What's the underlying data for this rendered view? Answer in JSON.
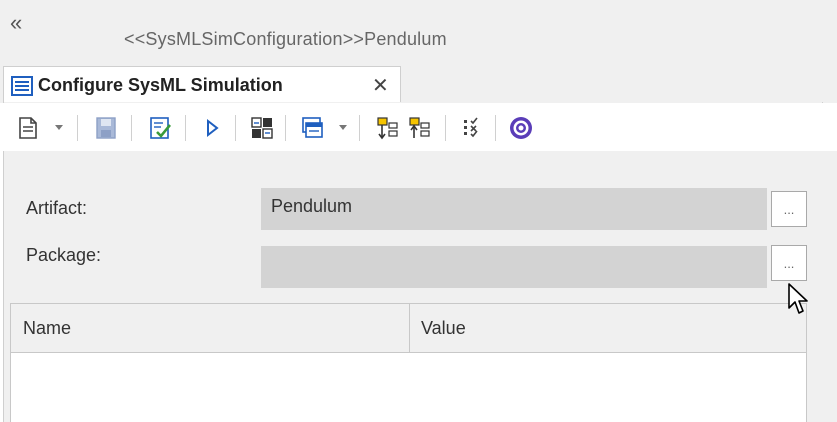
{
  "window": {
    "collapse_glyph": "«",
    "title": "<<SysMLSimConfiguration>>Pendulum"
  },
  "tab": {
    "label": "Configure SysML Simulation",
    "close_glyph": "✕",
    "icon": "document-list-icon"
  },
  "toolbar": {
    "buttons": [
      {
        "name": "new-document-icon",
        "dropdown": true
      },
      {
        "name": "save-icon"
      },
      {
        "name": "validate-icon"
      },
      {
        "name": "run-icon"
      },
      {
        "name": "generate-model-icon"
      },
      {
        "name": "windows-icon",
        "dropdown": true
      },
      {
        "name": "move-down-icon"
      },
      {
        "name": "move-up-icon"
      },
      {
        "name": "checklist-icon"
      },
      {
        "name": "help-icon"
      }
    ]
  },
  "form": {
    "artifact_label": "Artifact:",
    "artifact_value": "Pendulum",
    "package_label": "Package:",
    "package_value": "",
    "browse_label": "..."
  },
  "grid": {
    "columns": [
      "Name",
      "Value"
    ],
    "rows": []
  },
  "colors": {
    "accent_blue": "#1f5fbf",
    "field_gray": "#d3d3d3",
    "panel_gray": "#f0f0f0",
    "help_purple": "#5a3db8"
  }
}
